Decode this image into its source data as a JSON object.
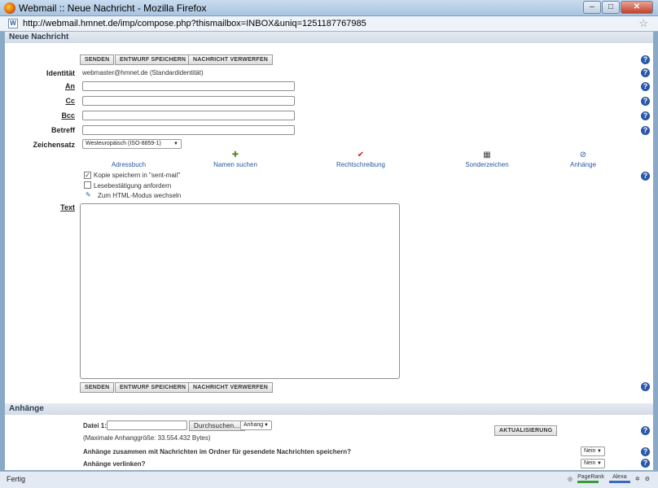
{
  "window": {
    "title": "Webmail :: Neue Nachricht - Mozilla Firefox",
    "url": "http://webmail.hmnet.de/imp/compose.php?thismailbox=INBOX&uniq=1251187767985"
  },
  "page": {
    "header": "Neue Nachricht",
    "buttons": {
      "send": "SENDEN",
      "draft": "ENTWURF SPEICHERN",
      "discard": "NACHRICHT VERWERFEN"
    },
    "identity": {
      "label": "Identität",
      "value": "webmaster@hmnet.de (Standardidentität)"
    },
    "fields": {
      "to": {
        "label": "An",
        "value": ""
      },
      "cc": {
        "label": "Cc",
        "value": ""
      },
      "bcc": {
        "label": "Bcc",
        "value": ""
      },
      "subject": {
        "label": "Betreff",
        "value": ""
      }
    },
    "charset": {
      "label": "Zeichensatz",
      "selected": "Westeuropäisch (ISO-8859-1)"
    },
    "tools": {
      "addressbook": "Adressbuch",
      "find_names": "Namen suchen",
      "spellcheck": "Rechtschreibung",
      "special_chars": "Sonderzeichen",
      "attachments": "Anhänge"
    },
    "options": {
      "save_copy": "Kopie speichern in \"sent-mail\"",
      "read_receipt": "Lesebestätigung anfordern",
      "html_mode": "Zum HTML-Modus wechseln"
    },
    "text_label": "Text",
    "attachments_section": {
      "header": "Anhänge",
      "file_label": "Datei 1:",
      "browse": "Durchsuchen...",
      "type_selected": "Anhang",
      "max_size": "(Maximale Anhanggröße: 33.554.432 Bytes)",
      "update": "AKTUALISIERUNG",
      "save_with_msg": "Anhänge zusammen mit Nachrichten im Ordner für gesendete Nachrichten speichern?",
      "save_with_msg_value": "Nein",
      "link_attachments": "Anhänge verlinken?",
      "link_attachments_value": "Nein"
    }
  },
  "status": {
    "text": "Fertig",
    "pagerank": "PageRank",
    "alexa": "Alexa"
  },
  "colors": {
    "help_icon": "#2958a8",
    "link": "#2858a0",
    "header_bg": "#d3dbe5"
  }
}
